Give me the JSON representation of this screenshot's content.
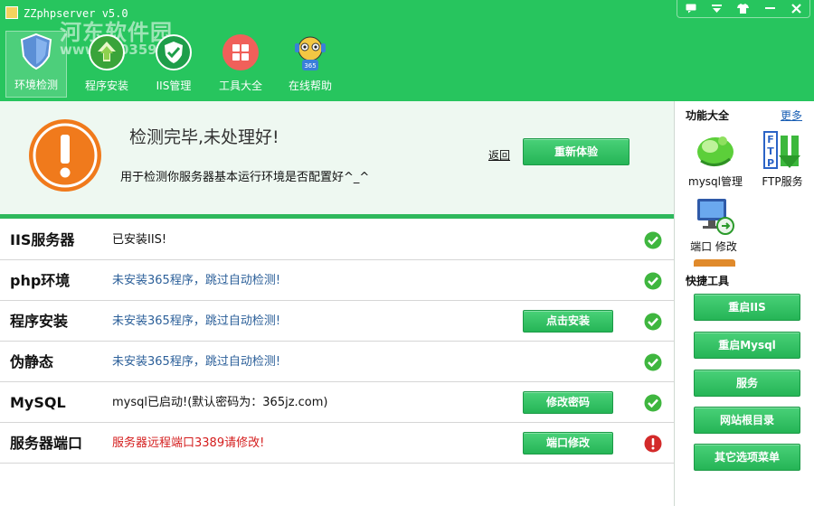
{
  "app": {
    "title": "ZZphpserver v5.0"
  },
  "watermark": {
    "text": "河东软件园",
    "url": "www.pc0359.cn"
  },
  "window_controls": [
    "comment-icon",
    "minimize-down-icon",
    "skin-icon",
    "minimize-icon",
    "close-icon"
  ],
  "nav": [
    {
      "label": "环境检测",
      "icon": "shield-icon",
      "active": true
    },
    {
      "label": "程序安装",
      "icon": "install-arrow-icon"
    },
    {
      "label": "IIS管理",
      "icon": "shield-check-icon"
    },
    {
      "label": "工具大全",
      "icon": "grid-icon"
    },
    {
      "label": "在线帮助",
      "icon": "robot-help-icon"
    }
  ],
  "status": {
    "title": "检测完毕,未处理好!",
    "description": "用于检测你服务器基本运行环境是否配置好^_^",
    "back_label": "返回",
    "retry_label": "重新体验"
  },
  "rows": [
    {
      "label": "IIS服务器",
      "value": "已安装IIS!",
      "value_color": "black",
      "button": "",
      "status": "ok"
    },
    {
      "label": "php环境",
      "value": "未安装365程序，跳过自动检测!",
      "value_color": "blue",
      "button": "",
      "status": "ok"
    },
    {
      "label": "程序安装",
      "value": "未安装365程序，跳过自动检测!",
      "value_color": "blue",
      "button": "点击安装",
      "status": "ok"
    },
    {
      "label": "伪静态",
      "value": "未安装365程序，跳过自动检测!",
      "value_color": "blue",
      "button": "",
      "status": "ok"
    },
    {
      "label": "MySQL",
      "value": "mysql已启动!(默认密码为：365jz.com)",
      "value_color": "black",
      "button": "修改密码",
      "status": "ok"
    },
    {
      "label": "服务器端口",
      "value": "服务器远程端口3389请修改!",
      "value_color": "red",
      "button": "端口修改",
      "status": "error"
    }
  ],
  "features": {
    "title": "功能大全",
    "more_label": "更多",
    "items": [
      {
        "label": "mysql管理",
        "icon": "mysql-icon"
      },
      {
        "label": "FTP服务",
        "icon": "ftp-icon"
      },
      {
        "label": "端口 修改",
        "icon": "monitor-port-icon"
      }
    ]
  },
  "tools": {
    "title": "快捷工具",
    "buttons": [
      "重启IIS",
      "重启Mysql",
      "服务",
      "网站根目录",
      "其它选项菜单"
    ]
  },
  "colors": {
    "header_green": "#27c55e",
    "button_green": "#2ebd5e",
    "ok_green": "#3fb63f",
    "error_red": "#d32a2a",
    "warning_orange": "#f07a1c"
  }
}
